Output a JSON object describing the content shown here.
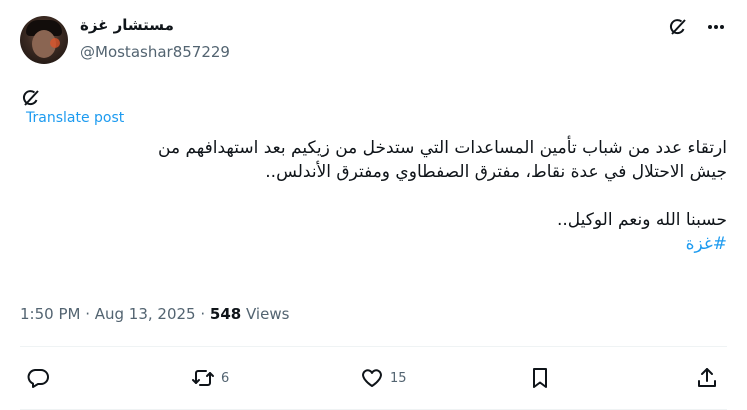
{
  "user": {
    "display_name": "مستشار غزة",
    "handle": "@Mostashar857229"
  },
  "icons": {
    "grok": "grok-icon",
    "more": "more-icon",
    "reply": "reply-icon",
    "repost": "repost-icon",
    "like": "heart-icon",
    "bookmark": "bookmark-icon",
    "share": "share-icon"
  },
  "post": {
    "translate_label": "Translate post",
    "line1": "ارتقاء عدد من شباب تأمين المساعدات التي ستدخل من زيكيم بعد استهدافهم من",
    "line2": "جيش الاحتلال في عدة نقاط، مفترق الصفطاوي ومفترق الأندلس..",
    "line3": "حسبنا الله ونعم الوكيل..",
    "hashtag": "#غزة"
  },
  "meta": {
    "time_date": "1:50 PM · Aug 13, 2025 · ",
    "views_count": "548",
    "views_label": " Views"
  },
  "actions": {
    "reply_count": "",
    "repost_count": "6",
    "like_count": "15"
  },
  "colors": {
    "accent": "#1d9bf0",
    "text": "#0f1419",
    "muted": "#536471"
  }
}
